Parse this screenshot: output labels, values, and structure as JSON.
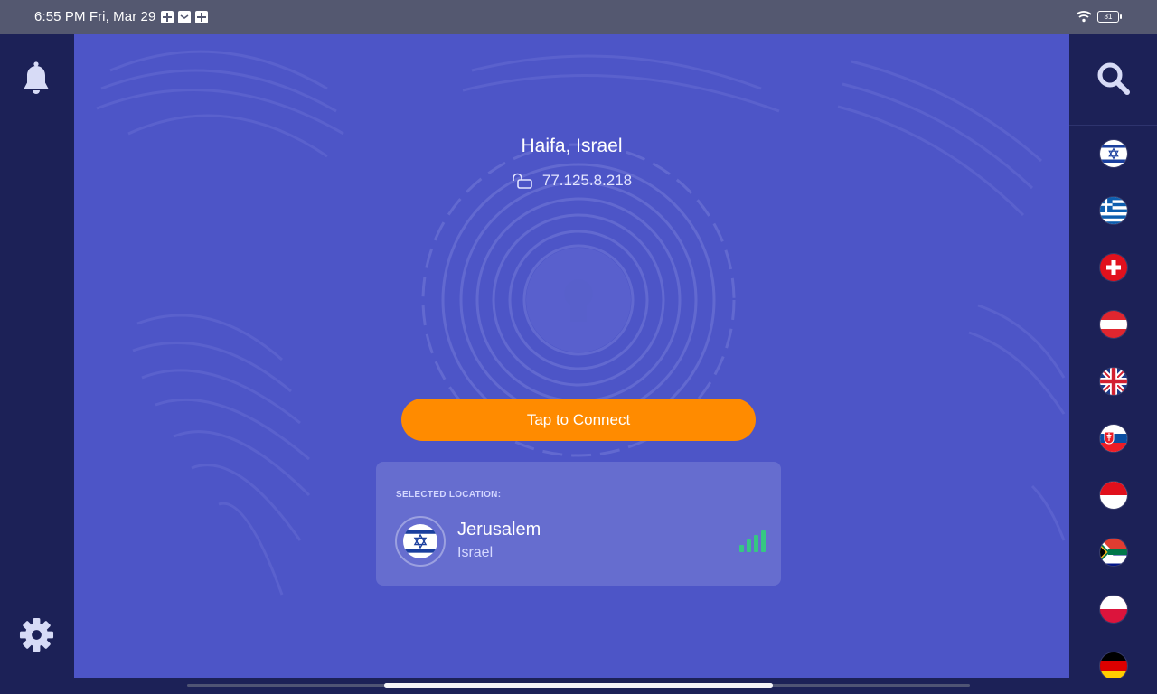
{
  "status_bar": {
    "time": "6:55 PM Fri, Mar 29",
    "battery": "81"
  },
  "sidebar_left": {
    "notifications_icon": "bell-icon",
    "settings_icon": "gear-icon"
  },
  "sidebar_right": {
    "search_icon": "search-icon",
    "flags": [
      "Israel",
      "Greece",
      "Switzerland",
      "Austria",
      "United Kingdom",
      "Slovakia",
      "Indonesia",
      "South Africa",
      "Poland",
      "Germany"
    ]
  },
  "main": {
    "current_location": "Haifa, Israel",
    "ip_address": "77.125.8.218",
    "connect_button": "Tap to Connect",
    "selected_label": "SELECTED LOCATION:",
    "selected_city": "Jerusalem",
    "selected_country": "Israel"
  },
  "colors": {
    "main_bg": "#4d55c7",
    "rail_bg": "#1c2157",
    "connect": "#ff8b00",
    "signal": "#36c783"
  }
}
